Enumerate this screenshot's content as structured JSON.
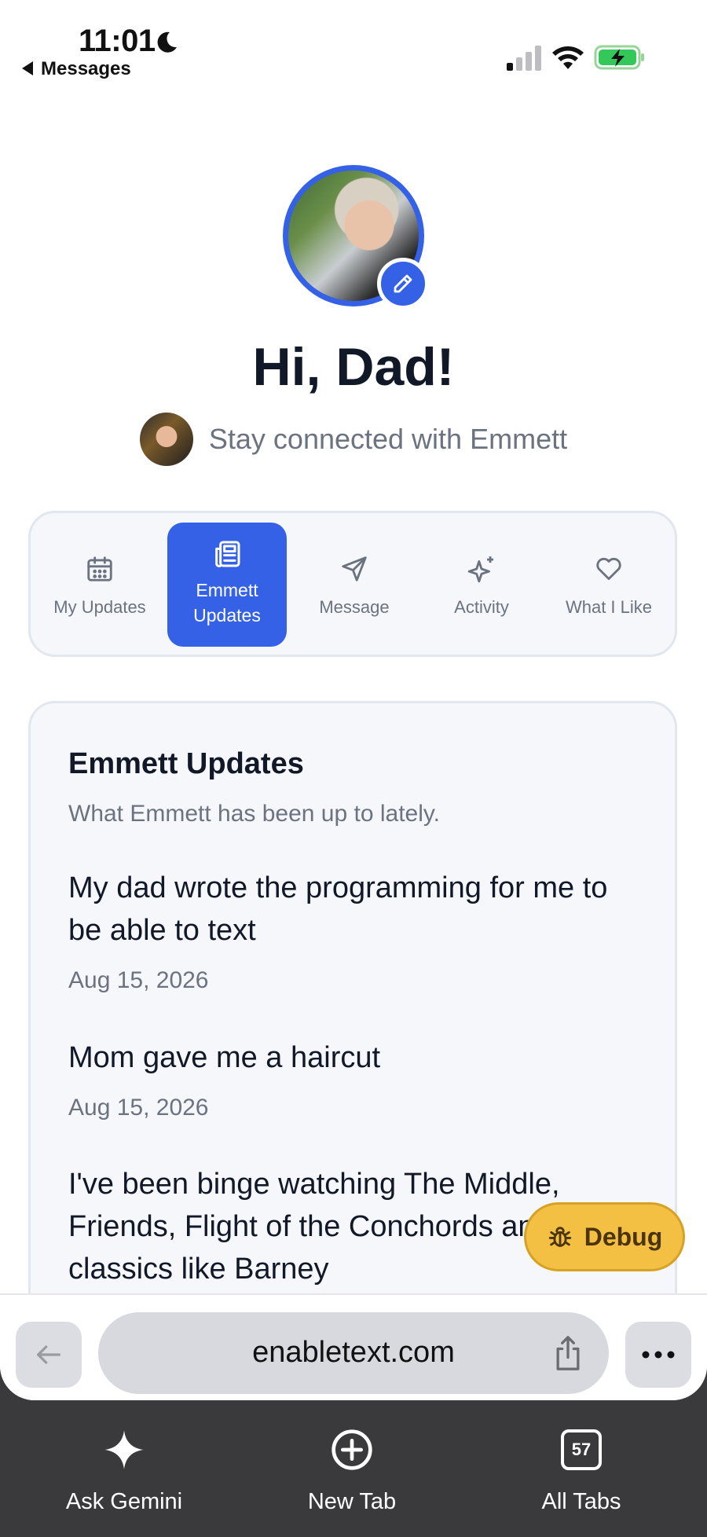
{
  "status_bar": {
    "time": "11:01",
    "back_label": "Messages"
  },
  "profile": {
    "greeting": "Hi, Dad!",
    "subtitle": "Stay connected with Emmett"
  },
  "tabs": [
    {
      "label": "My Updates",
      "icon": "calendar-icon",
      "active": false
    },
    {
      "label": "Emmett\nUpdates",
      "icon": "newspaper-icon",
      "active": true
    },
    {
      "label": "Message",
      "icon": "send-icon",
      "active": false
    },
    {
      "label": "Activity",
      "icon": "sparkles-icon",
      "active": false
    },
    {
      "label": "What I Like",
      "icon": "heart-icon",
      "active": false
    }
  ],
  "card": {
    "title": "Emmett Updates",
    "subtitle": "What Emmett has been up to lately.",
    "updates": [
      {
        "text": "My dad wrote the programming for me to be able to text",
        "date": "Aug 15, 2026"
      },
      {
        "text": "Mom gave me a haircut",
        "date": "Aug 15, 2026"
      },
      {
        "text": "I've been binge watching The Middle, Friends, Flight of the Conchords and other classics like Barney",
        "date": ""
      }
    ]
  },
  "debug_button": {
    "label": "Debug"
  },
  "browser": {
    "url": "enabletext.com"
  },
  "toolbar": {
    "gemini_label": "Ask Gemini",
    "new_tab_label": "New Tab",
    "all_tabs_label": "All Tabs",
    "tab_count": "57"
  },
  "colors": {
    "accent": "#3461e5",
    "debug": "#f4c043",
    "toolbar_bg": "#3a3a3c"
  }
}
